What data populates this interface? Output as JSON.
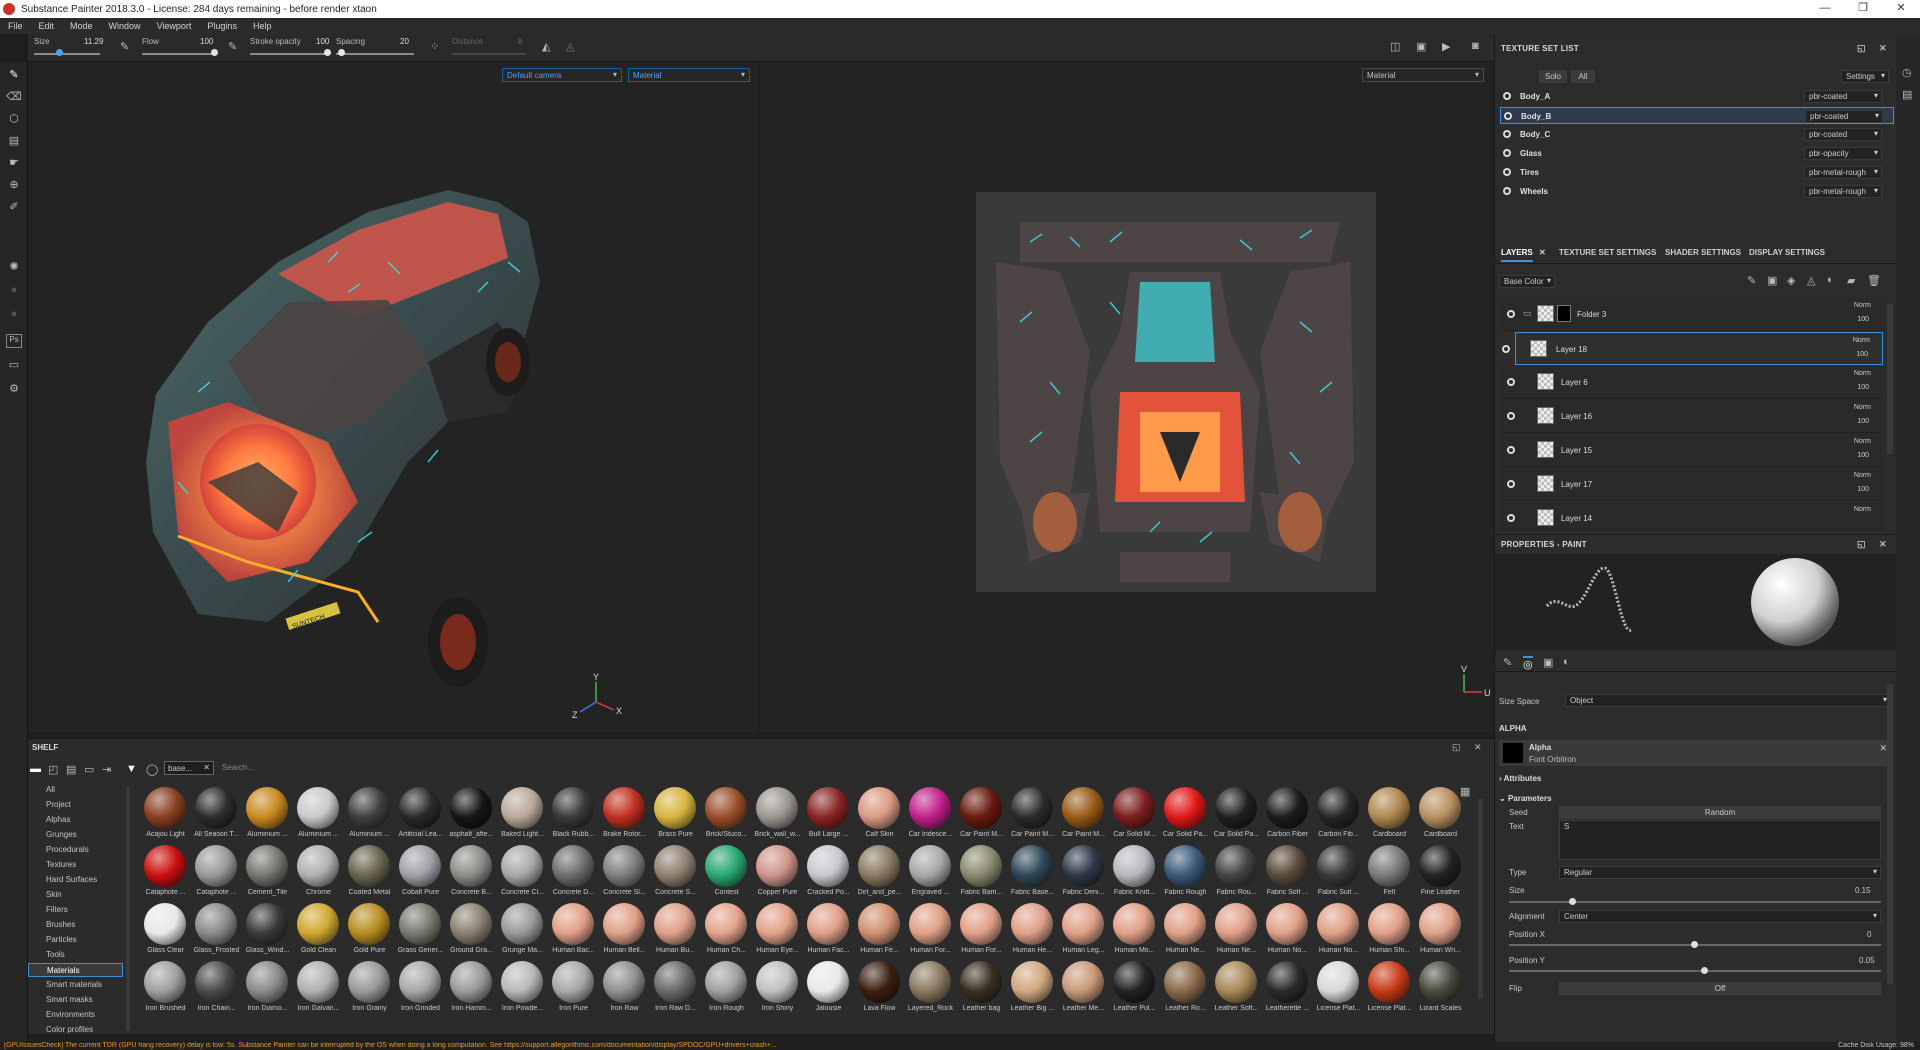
{
  "window": {
    "title": "Substance Painter 2018.3.0 - License: 284 days remaining - before render xtaon"
  },
  "menu": [
    "File",
    "Edit",
    "Mode",
    "Window",
    "Viewport",
    "Plugins",
    "Help"
  ],
  "toolbar": {
    "size_label": "Size",
    "size_value": "11.29",
    "flow_label": "Flow",
    "flow_value": "100",
    "stroke_label": "Stroke opacity",
    "stroke_value": "100",
    "spacing_label": "Spacing",
    "spacing_value": "20",
    "distance_label": "Distance",
    "distance_value": "8"
  },
  "viewport": {
    "camera": "Default camera",
    "mode_3d": "Material",
    "mode_2d": "Material",
    "axis_y": "Y",
    "axis_x": "X",
    "axis_z": "Z",
    "uv_v": "V",
    "uv_u": "U",
    "plate_text": "SUNTECH"
  },
  "texture_set_list": {
    "title": "TEXTURE SET LIST",
    "solo": "Solo",
    "all": "All",
    "settings": "Settings",
    "sets": [
      {
        "name": "Body_A",
        "shader": "pbr-coated"
      },
      {
        "name": "Body_B",
        "shader": "pbr-coated"
      },
      {
        "name": "Body_C",
        "shader": "pbr-coated"
      },
      {
        "name": "Glass",
        "shader": "pbr-opacity"
      },
      {
        "name": "Tires",
        "shader": "pbr-metal-rough"
      },
      {
        "name": "Wheels",
        "shader": "pbr-metal-rough"
      }
    ]
  },
  "layers_panel": {
    "tabs": [
      "LAYERS",
      "TEXTURE SET SETTINGS",
      "SHADER SETTINGS",
      "DISPLAY SETTINGS"
    ],
    "channel": "Base Color",
    "layers": [
      {
        "name": "Folder 3",
        "blend": "Norm",
        "opacity": "100"
      },
      {
        "name": "Layer 18",
        "blend": "Norm",
        "opacity": "100"
      },
      {
        "name": "Layer 6",
        "blend": "Norm",
        "opacity": "100"
      },
      {
        "name": "Layer 16",
        "blend": "Norm",
        "opacity": "100"
      },
      {
        "name": "Layer 15",
        "blend": "Norm",
        "opacity": "100"
      },
      {
        "name": "Layer 17",
        "blend": "Norm",
        "opacity": "100"
      },
      {
        "name": "Layer 14",
        "blend": "Norm",
        "opacity": ""
      }
    ]
  },
  "properties": {
    "title": "PROPERTIES - PAINT",
    "size_space_label": "Size Space",
    "size_space_value": "Object",
    "alpha_header": "ALPHA",
    "alpha_name": "Alpha",
    "alpha_sub": "Font Orbitron",
    "attributes": "Attributes",
    "parameters": "Parameters",
    "seed_label": "Seed",
    "seed_value": "Random",
    "text_label": "Text",
    "text_value": "S",
    "type_label": "Type",
    "type_value": "Regular",
    "size_label": "Size",
    "size_value": "0.15",
    "alignment_label": "Alignment",
    "alignment_value": "Center",
    "posx_label": "Position X",
    "posx_value": "0",
    "posy_label": "Position Y",
    "posy_value": "0.05",
    "flip_label": "Flip",
    "flip_value": "Off"
  },
  "shelf": {
    "title": "SHELF",
    "filter_tag": "base...",
    "search_placeholder": "Search...",
    "categories": [
      "All",
      "Project",
      "Alphas",
      "Grunges",
      "Procedurals",
      "Textures",
      "Hard Surfaces",
      "Skin",
      "Filters",
      "Brushes",
      "Particles",
      "Tools",
      "Materials",
      "Smart materials",
      "Smart masks",
      "Environments",
      "Color profiles"
    ],
    "selected_category": "Materials",
    "materials": [
      {
        "n": "Acajou Light",
        "c": "#8a3f22"
      },
      {
        "n": "All Season T...",
        "c": "#2c2c2e"
      },
      {
        "n": "Aluminium ...",
        "c": "#c8891e"
      },
      {
        "n": "Aluminium ...",
        "c": "#c9c9c9"
      },
      {
        "n": "Aluminium ...",
        "c": "#404040"
      },
      {
        "n": "Artificial Lea...",
        "c": "#2a2a2a"
      },
      {
        "n": "asphalt_afte...",
        "c": "#161616"
      },
      {
        "n": "Baked Light...",
        "c": "#b8a99a"
      },
      {
        "n": "Black Rubb...",
        "c": "#3a3a3a"
      },
      {
        "n": "Brake Rotor...",
        "c": "#c03020"
      },
      {
        "n": "Brass Pure",
        "c": "#d8b440"
      },
      {
        "n": "Brick/Stuco...",
        "c": "#9a4e2a"
      },
      {
        "n": "Brick_wall_w...",
        "c": "#9c9690"
      },
      {
        "n": "Bull Large ...",
        "c": "#8a2424"
      },
      {
        "n": "Calf Skin",
        "c": "#d99a82"
      },
      {
        "n": "Car Iridesce...",
        "c": "#c0208a"
      },
      {
        "n": "Car Paint M...",
        "c": "#6a1a0e"
      },
      {
        "n": "Car Paint M...",
        "c": "#2b2b2b"
      },
      {
        "n": "Car Paint M...",
        "c": "#9a5a18"
      },
      {
        "n": "Car Solid M...",
        "c": "#7a1e1e"
      },
      {
        "n": "Car Solid Pa...",
        "c": "#e01818"
      },
      {
        "n": "Car Solid Pa...",
        "c": "#202020"
      },
      {
        "n": "Carbon Fiber",
        "c": "#1c1c1c"
      },
      {
        "n": "Carbon Fib...",
        "c": "#262626"
      },
      {
        "n": "Cardboard",
        "c": "#b08850"
      },
      {
        "n": "Cardboard",
        "c": "#b89060"
      },
      {
        "n": "Cataphote ...",
        "c": "#cc1010"
      },
      {
        "n": "Cataphote ...",
        "c": "#9a9a9a"
      },
      {
        "n": "Cement_Tile",
        "c": "#777770"
      },
      {
        "n": "Chrome",
        "c": "#b0b0b0"
      },
      {
        "n": "Coated Metal",
        "c": "#6a6650"
      },
      {
        "n": "Cobalt Pure",
        "c": "#a0a0a8"
      },
      {
        "n": "Concrete B...",
        "c": "#8c8c88"
      },
      {
        "n": "Concrete Cl...",
        "c": "#a8a8a8"
      },
      {
        "n": "Concrete D...",
        "c": "#6e6e6e"
      },
      {
        "n": "Concrete Sl...",
        "c": "#7e7e7e"
      },
      {
        "n": "Concrete S...",
        "c": "#908070"
      },
      {
        "n": "Contest",
        "c": "#28a870"
      },
      {
        "n": "Copper Pure",
        "c": "#d0968a"
      },
      {
        "n": "Cracked Po...",
        "c": "#c8c8d0"
      },
      {
        "n": "Dirt_and_pe...",
        "c": "#8a7a60"
      },
      {
        "n": "Engraved ...",
        "c": "#a8a8a8"
      },
      {
        "n": "Fabric Bam...",
        "c": "#8a8a70"
      },
      {
        "n": "Fabric Base...",
        "c": "#2e4858"
      },
      {
        "n": "Fabric Deni...",
        "c": "#2e3848"
      },
      {
        "n": "Fabric Knitt...",
        "c": "#b8b8c0"
      },
      {
        "n": "Fabric Rough",
        "c": "#3a5a78"
      },
      {
        "n": "Fabric Rou...",
        "c": "#444444"
      },
      {
        "n": "Fabric Soft ...",
        "c": "#5a4a3a"
      },
      {
        "n": "Fabric Suit ...",
        "c": "#3a3a3a"
      },
      {
        "n": "Felt",
        "c": "#7a7a7a"
      },
      {
        "n": "Fine Leather",
        "c": "#222222"
      },
      {
        "n": "Glass Clear",
        "c": "#e8e8e8"
      },
      {
        "n": "Glass_Frosted",
        "c": "#8a8a8a"
      },
      {
        "n": "Glass_Wind...",
        "c": "#3a3a3a"
      },
      {
        "n": "Gold Clean",
        "c": "#d0a830"
      },
      {
        "n": "Gold Pure",
        "c": "#b88c20"
      },
      {
        "n": "Grass Gener...",
        "c": "#7a7a70"
      },
      {
        "n": "Ground Gra...",
        "c": "#8a8070"
      },
      {
        "n": "Grunge Ma...",
        "c": "#9a9a9a"
      },
      {
        "n": "Human Bac...",
        "c": "#e0a088"
      },
      {
        "n": "Human Bell...",
        "c": "#e0a088"
      },
      {
        "n": "Human Bu...",
        "c": "#dfa089"
      },
      {
        "n": "Human Ch...",
        "c": "#e3a48c"
      },
      {
        "n": "Human Eye...",
        "c": "#e2a28a"
      },
      {
        "n": "Human Fac...",
        "c": "#e0a088"
      },
      {
        "n": "Human Fe...",
        "c": "#d09070"
      },
      {
        "n": "Human For...",
        "c": "#e0a088"
      },
      {
        "n": "Human For...",
        "c": "#e0a088"
      },
      {
        "n": "Human He...",
        "c": "#dfa089"
      },
      {
        "n": "Human Leg...",
        "c": "#e0a088"
      },
      {
        "n": "Human Mo...",
        "c": "#e0a088"
      },
      {
        "n": "Human Ne...",
        "c": "#e0a088"
      },
      {
        "n": "Human Ne...",
        "c": "#e0a088"
      },
      {
        "n": "Human No...",
        "c": "#e0a088"
      },
      {
        "n": "Human No...",
        "c": "#e0a088"
      },
      {
        "n": "Human Shi...",
        "c": "#e0a088"
      },
      {
        "n": "Human Wri...",
        "c": "#e0a088"
      },
      {
        "n": "Iron Brushed",
        "c": "#a0a0a0"
      },
      {
        "n": "Iron Chain...",
        "c": "#4a4a4a"
      },
      {
        "n": "Iron Diamo...",
        "c": "#8a8a8a"
      },
      {
        "n": "Iron Galvan...",
        "c": "#b0b0b0"
      },
      {
        "n": "Iron Grainy",
        "c": "#9a9a9a"
      },
      {
        "n": "Iron Grinded",
        "c": "#a8a8a8"
      },
      {
        "n": "Iron Hamm...",
        "c": "#9a9a9a"
      },
      {
        "n": "Iron Powde...",
        "c": "#b8b8b8"
      },
      {
        "n": "Iron Pure",
        "c": "#a8a8a8"
      },
      {
        "n": "Iron Raw",
        "c": "#909090"
      },
      {
        "n": "Iron Raw D...",
        "c": "#6a6a6a"
      },
      {
        "n": "Iron Rough",
        "c": "#a0a0a0"
      },
      {
        "n": "Iron Shiny",
        "c": "#c0c0c0"
      },
      {
        "n": "Jalousie",
        "c": "#e8e8e8"
      },
      {
        "n": "Lava Flow",
        "c": "#3a2010"
      },
      {
        "n": "Layered_Rock",
        "c": "#8a7860"
      },
      {
        "n": "Leather bag",
        "c": "#3a3020"
      },
      {
        "n": "Leather Big ...",
        "c": "#d0a880"
      },
      {
        "n": "Leather Me...",
        "c": "#c89878"
      },
      {
        "n": "Leather Pol...",
        "c": "#222222"
      },
      {
        "n": "Leather Ro...",
        "c": "#8a6a4a"
      },
      {
        "n": "Leather Soft...",
        "c": "#a88858"
      },
      {
        "n": "Leatherette ...",
        "c": "#2a2a2a"
      },
      {
        "n": "License Plat...",
        "c": "#d8d8d8"
      },
      {
        "n": "License Plat...",
        "c": "#c83a18"
      },
      {
        "n": "Lizard Scales",
        "c": "#4a4a40"
      }
    ]
  },
  "status": {
    "message": "[GPUIssuesCheck] The current TDR (GPU hang recovery) delay is low: 5s. Substance Painter can be interrupted by the OS when doing a long computation. See https://support.allegorithmic.com/documentation/display/SPDOC/GPU+drivers+crash+...",
    "cache": "Cache Disk Usage:  98%"
  }
}
